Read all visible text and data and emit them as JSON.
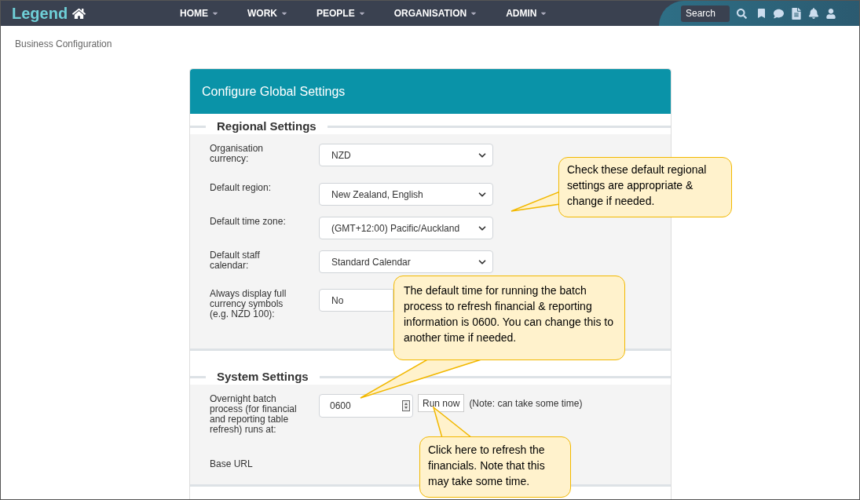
{
  "app": {
    "logo": "Legend"
  },
  "nav": [
    {
      "label": "HOME"
    },
    {
      "label": "WORK"
    },
    {
      "label": "PEOPLE"
    },
    {
      "label": "ORGANISATION"
    },
    {
      "label": "ADMIN"
    }
  ],
  "search": {
    "placeholder": "Search"
  },
  "breadcrumb": "Business Configuration",
  "card": {
    "title": "Configure Global Settings"
  },
  "sections": [
    {
      "title": "Regional Settings",
      "fields": [
        {
          "kind": "select",
          "label": "Organisation currency:",
          "value": "NZD"
        },
        {
          "kind": "select",
          "label": "Default region:",
          "value": "New Zealand, English"
        },
        {
          "kind": "select",
          "label": "Default time zone:",
          "value": "(GMT+12:00) Pacific/Auckland"
        },
        {
          "kind": "select",
          "label": "Default staff calendar:",
          "value": "Standard Calendar"
        },
        {
          "kind": "select",
          "label": "Always display full currency symbols (e.g. NZD 100):",
          "value": "No"
        }
      ]
    },
    {
      "title": "System Settings",
      "fields": [
        {
          "kind": "time",
          "label": "Overnight batch process (for financial and reporting table refresh) runs at:",
          "value": "0600",
          "button": "Run now",
          "note": "(Note: can take some time)"
        },
        {
          "kind": "text",
          "label": "Base URL"
        }
      ]
    }
  ],
  "callouts": [
    {
      "text": "Check these default regional settings are appropriate & change if needed."
    },
    {
      "text": "The default time for running the batch process to refresh financial & reporting information is 0600.  You can change this to another time if needed."
    },
    {
      "text": "Click here to refresh the financials.  Note that this may take some time."
    }
  ]
}
